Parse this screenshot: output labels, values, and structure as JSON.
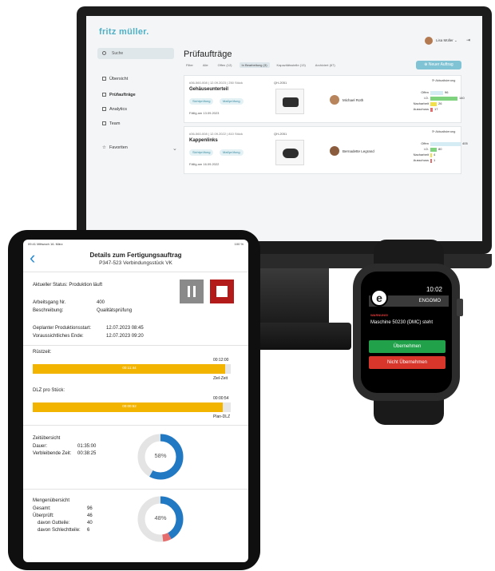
{
  "monitor": {
    "logo": "fritz müller.",
    "user": "Lisa Müller ⌄",
    "search": "Suche",
    "nav": [
      {
        "label": "Übersicht",
        "icon": "home-icon"
      },
      {
        "label": "Prüfaufträge",
        "icon": "pin-icon"
      },
      {
        "label": "Analytics",
        "icon": "chart-icon"
      },
      {
        "label": "Team",
        "icon": "team-icon"
      }
    ],
    "favorites": "Favoriten",
    "title": "Prüfaufträge",
    "tabs": [
      "Filter",
      "Alle",
      "Offen (12)",
      "In Bearbeitung (3)",
      "Kapazitätsstelle (13)",
      "Archiviert (67)"
    ],
    "new_button": "Neuer Auftrag",
    "cards": [
      {
        "meta": "#36-560-008 | 12.09.2023 | 250 Stück",
        "name": "Gehäuseunterteil",
        "chips": [
          "Sichtprüfung",
          "Maßprüfung"
        ],
        "due": "Fällig am 13.09.2023",
        "qr": "QH-2051",
        "person": "Michael Roth",
        "refresh": "Aktualisierung",
        "bars": [
          {
            "label": "Offen",
            "value": "96",
            "fill": 0.4,
            "color": "#d6ecf5"
          },
          {
            "label": "i.O.",
            "value": "140",
            "fill": 0.85,
            "color": "#7fd37f"
          },
          {
            "label": "Nacharbeit",
            "value": "26",
            "fill": 0.2,
            "color": "#f1e04a"
          },
          {
            "label": "Ausschuss",
            "value": "17",
            "fill": 0.08,
            "color": "#e56d6d"
          }
        ]
      },
      {
        "meta": "#36-560-008 | 12.09.2022 | 810 Stück",
        "name": "Kappenlinks",
        "chips": [
          "Sichtprüfung",
          "Maßprüfung"
        ],
        "due": "Fällig am 16.09.2022",
        "qr": "QH-2051",
        "person": "Bernadette Legrand",
        "refresh": "Aktualisierung",
        "bars": [
          {
            "label": "Offen",
            "value": "405",
            "fill": 0.95,
            "color": "#d6ecf5"
          },
          {
            "label": "i.O.",
            "value": "80",
            "fill": 0.2,
            "color": "#7fd37f"
          },
          {
            "label": "Nacharbeit",
            "value": "4",
            "fill": 0.03,
            "color": "#f1e04a"
          },
          {
            "label": "Ausschuss",
            "value": "1",
            "fill": 0.02,
            "color": "#e56d6d"
          }
        ]
      }
    ]
  },
  "tablet": {
    "status_left": "09:41  Mittwoch 16. März",
    "status_right": "100 %",
    "title": "Details zum Fertigungsauftrag",
    "subtitle": "P347-523 Verbindungsstück VK",
    "status_line": "Aktueller Status: Produktion läuft",
    "arbeitsgang_label": "Arbeitsgang Nr.",
    "arbeitsgang_value": "400",
    "beschreibung_label": "Beschreibung:",
    "beschreibung_value": "Qualitätsprüfung",
    "start_label": "Geplanter Produktionsstart:",
    "start_value": "12.07.2023 08:45",
    "end_label": "Voraussichtliches Ende:",
    "end_value": "12.07.2023 09:20",
    "ruestzeit": {
      "label": "Rüstzeit:",
      "target": "00:12:00",
      "value": "00:11:44",
      "caption": "Ziel-Zeit",
      "fill": 0.97
    },
    "dlz": {
      "label": "DLZ pro Stück:",
      "target": "00:00:54",
      "value": "00:00:52",
      "caption": "Plan-DLZ",
      "fill": 0.96
    },
    "zeit": {
      "heading": "Zeitübersicht",
      "dauer_label": "Dauer:",
      "dauer_value": "01:35:00",
      "rest_label": "Verbleibende Zeit:",
      "rest_value": "00:38:25",
      "percent": "58%",
      "fraction": 0.58
    },
    "menge": {
      "heading": "Mengenübersicht",
      "gesamt_label": "Gesamt:",
      "gesamt_value": "96",
      "ueberprueft_label": "Überprüft:",
      "ueberprueft_value": "46",
      "gut_label": "davon Gutteile:",
      "gut_value": "40",
      "schlecht_label": "davon Schlechtteile:",
      "schlecht_value": "6",
      "percent": "48%",
      "fraction": 0.48,
      "bad_fraction": 0.06
    }
  },
  "watch": {
    "time": "10:02",
    "logo": "e",
    "brand": "ENGOMO",
    "warning": "WARNUNG!",
    "message": "Maschine 50230 (DMC) steht",
    "accept": "Übernehmen",
    "reject": "Nicht Übernehmen"
  },
  "colors": {
    "accent": "#4fb0c6",
    "progress": "#f3b400",
    "donut": "#2179c4",
    "stop": "#b31b1b"
  }
}
